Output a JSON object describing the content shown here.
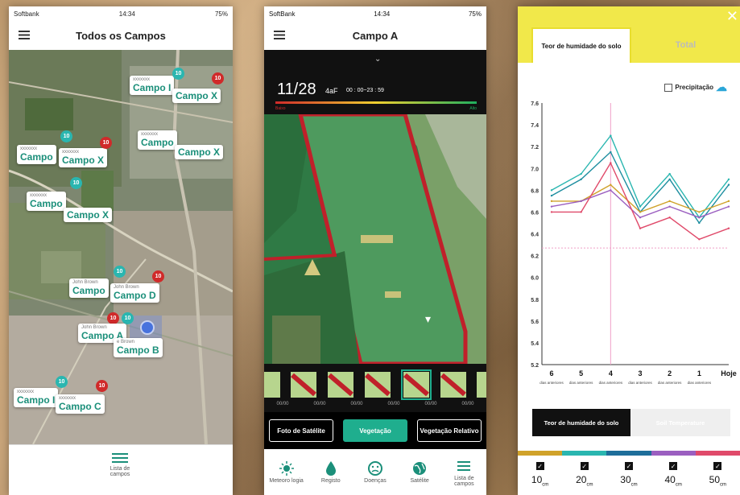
{
  "phone1": {
    "status": {
      "carrier": "Softbank",
      "time": "14:34",
      "battery": "75%"
    },
    "title": "Todos os Campos",
    "fields": [
      {
        "name": "Campo I",
        "owner": "xxxxxxx",
        "badge_teal": "10",
        "badge_red": "10"
      },
      {
        "name": "Campo X",
        "owner": "",
        "badge_teal": "",
        "badge_red": ""
      },
      {
        "name": "Campo",
        "owner": "xxxxxxx",
        "badge_teal": "10",
        "badge_red": ""
      },
      {
        "name": "Campo X",
        "owner": "",
        "badge_teal": "",
        "badge_red": ""
      },
      {
        "name": "Campo",
        "owner": "xxxxxxx",
        "badge_teal": "",
        "badge_red": ""
      },
      {
        "name": "Campo X",
        "owner": "xxxxxxx",
        "badge_teal": "",
        "badge_red": "10"
      },
      {
        "name": "Campo",
        "owner": "xxxxxxx",
        "badge_teal": "10",
        "badge_red": ""
      },
      {
        "name": "Campo X",
        "owner": "",
        "badge_teal": "",
        "badge_red": ""
      },
      {
        "name": "Campo",
        "owner": "John Brown",
        "badge_teal": "10",
        "badge_red": ""
      },
      {
        "name": "Campo D",
        "owner": "John Brown",
        "badge_teal": "",
        "badge_red": "10"
      },
      {
        "name": "Campo A",
        "owner": "John Brown",
        "badge_teal": "10",
        "badge_red": "10"
      },
      {
        "name": "Campo B",
        "owner": "e Brown",
        "badge_teal": "",
        "badge_red": ""
      },
      {
        "name": "Campo I",
        "owner": "xxxxxxx",
        "badge_teal": "10",
        "badge_red": ""
      },
      {
        "name": "Campo C",
        "owner": "xxxxxxx",
        "badge_teal": "",
        "badge_red": "10"
      }
    ],
    "tab_label": "Lista de campos"
  },
  "phone2": {
    "status": {
      "carrier": "SoftBank",
      "time": "14:34",
      "battery": "75%"
    },
    "title": "Campo A",
    "date": "11/28",
    "date_sub": "4aF",
    "time_range": "00 : 00~23 : 59",
    "scale_low": "Baixo",
    "scale_high": "Alto",
    "thumb_label": "00/00",
    "buttons": [
      "Foto de Satélite",
      "Vegetação",
      "Vegetação Relativo"
    ],
    "tabs": [
      "Meteoro logia",
      "Registo",
      "Doenças",
      "Satélite",
      "Lista de campos"
    ]
  },
  "phone3": {
    "tab_active": "Teor de humidade do solo",
    "tab_other": "Total",
    "precip_label": "Precipitação",
    "y_ticks": [
      "7.6",
      "7.4",
      "7.2",
      "7.0",
      "6.8",
      "6.6",
      "6.4",
      "6.2",
      "6.0",
      "5.8",
      "5.6",
      "5.4",
      "5.2"
    ],
    "x_ticks": [
      "6",
      "5",
      "4",
      "3",
      "2",
      "1",
      "Hoje"
    ],
    "x_sub": "dias anteriores",
    "bottom_tabs": [
      "Teor de humidade do solo",
      "Soil Temperature"
    ],
    "depths": [
      "10",
      "20",
      "30",
      "40",
      "50"
    ],
    "depth_unit": "cm",
    "colors": {
      "yellow": "#f1e84a",
      "teal": "#1fae8e"
    }
  },
  "chart_data": {
    "type": "line",
    "x": [
      "6",
      "5",
      "4",
      "3",
      "2",
      "1",
      "Hoje"
    ],
    "ylim": [
      5.2,
      7.6
    ],
    "series": [
      {
        "values": [
          6.8,
          6.95,
          7.3,
          6.65,
          6.95,
          6.55,
          6.9
        ]
      },
      {
        "values": [
          6.75,
          6.9,
          7.15,
          6.6,
          6.9,
          6.5,
          6.85
        ]
      },
      {
        "values": [
          6.7,
          6.7,
          6.85,
          6.6,
          6.7,
          6.6,
          6.7
        ]
      },
      {
        "values": [
          6.65,
          6.7,
          6.8,
          6.55,
          6.65,
          6.55,
          6.65
        ]
      },
      {
        "values": [
          6.6,
          6.6,
          7.05,
          6.45,
          6.55,
          6.35,
          6.45
        ]
      }
    ]
  }
}
